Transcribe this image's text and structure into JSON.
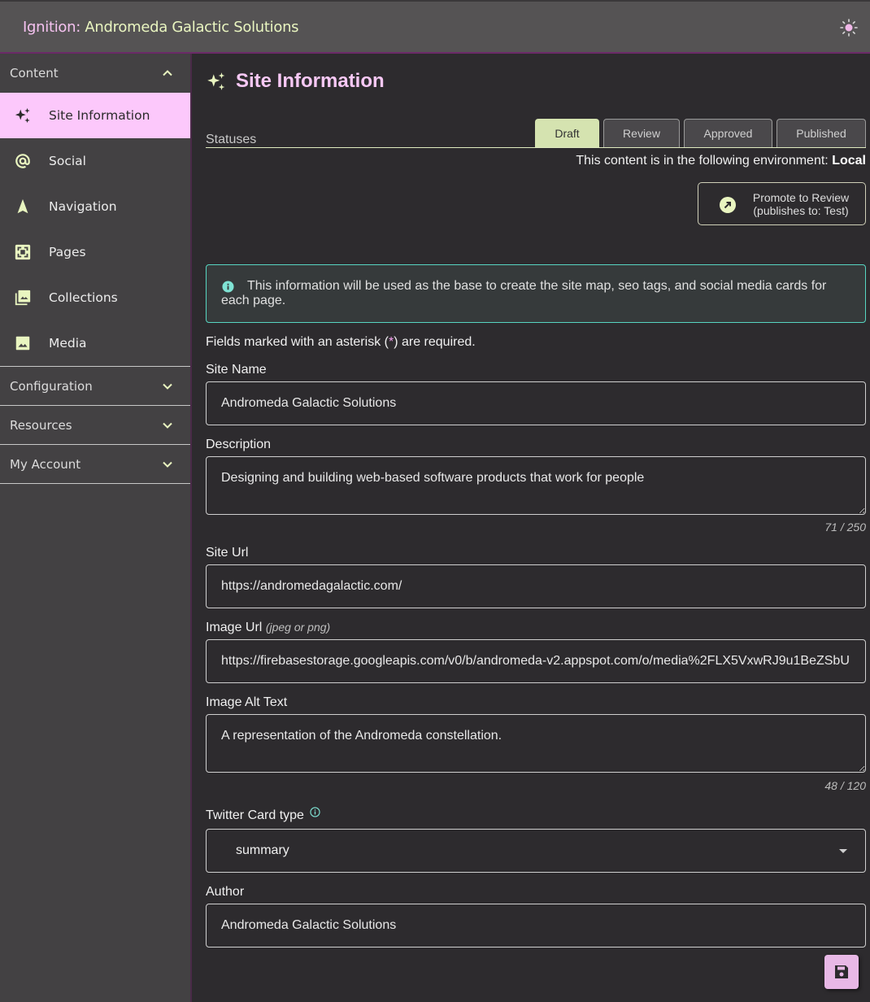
{
  "app": {
    "title_prefix": "Ignition:",
    "title_name": "Andromeda Galactic Solutions",
    "theme_toggle_icon": "sun-icon"
  },
  "colors": {
    "accent_pink": "#fcc8fb",
    "accent_green": "#e9f5c0",
    "info_border": "#57d6c2",
    "tab_active": "#d5e3b0"
  },
  "sidebar": {
    "sections": [
      {
        "label": "Content",
        "expanded": true,
        "items": [
          {
            "label": "Site Information",
            "icon": "sparkles-icon",
            "active": true
          },
          {
            "label": "Social",
            "icon": "at-sign-icon",
            "active": false
          },
          {
            "label": "Navigation",
            "icon": "navigation-arrow-icon",
            "active": false
          },
          {
            "label": "Pages",
            "icon": "pages-frame-icon",
            "active": false
          },
          {
            "label": "Collections",
            "icon": "photo-library-icon",
            "active": false
          },
          {
            "label": "Media",
            "icon": "image-icon",
            "active": false
          }
        ]
      },
      {
        "label": "Configuration",
        "expanded": false
      },
      {
        "label": "Resources",
        "expanded": false
      },
      {
        "label": "My Account",
        "expanded": false
      }
    ]
  },
  "main": {
    "title": "Site Information",
    "statuses_label": "Statuses",
    "tabs": [
      {
        "label": "Draft",
        "active": true
      },
      {
        "label": "Review",
        "active": false
      },
      {
        "label": "Approved",
        "active": false
      },
      {
        "label": "Published",
        "active": false
      }
    ],
    "environment_text": "This content is in the following environment:",
    "environment_value": "Local",
    "promote_button": {
      "line1": "Promote to Review",
      "line2": "(publishes to: Test)"
    },
    "info_message": "This information will be used as the base to create the site map, seo tags, and social media cards for each page.",
    "required_note_before": "Fields marked with an asterisk (",
    "required_note_asterisk": "*",
    "required_note_after": ") are required.",
    "fields": {
      "site_name": {
        "label": "Site Name",
        "value": "Andromeda Galactic Solutions"
      },
      "description": {
        "label": "Description",
        "value": "Designing and building web-based software products that work for people",
        "counter": "71 / 250"
      },
      "site_url": {
        "label": "Site Url",
        "value": "https://andromedagalactic.com/"
      },
      "image_url": {
        "label": "Image Url",
        "hint": "(jpeg or png)",
        "value": "https://firebasestorage.googleapis.com/v0/b/andromeda-v2.appspot.com/o/media%2FLX5VxwRJ9u1BeZSbU..."
      },
      "image_alt": {
        "label": "Image Alt Text",
        "value": "A representation of the Andromeda constellation.",
        "counter": "48 / 120"
      },
      "twitter_card": {
        "label": "Twitter Card type",
        "value": "summary"
      },
      "author": {
        "label": "Author",
        "value": "Andromeda Galactic Solutions"
      }
    },
    "save_button_icon": "save-floppy-icon"
  }
}
